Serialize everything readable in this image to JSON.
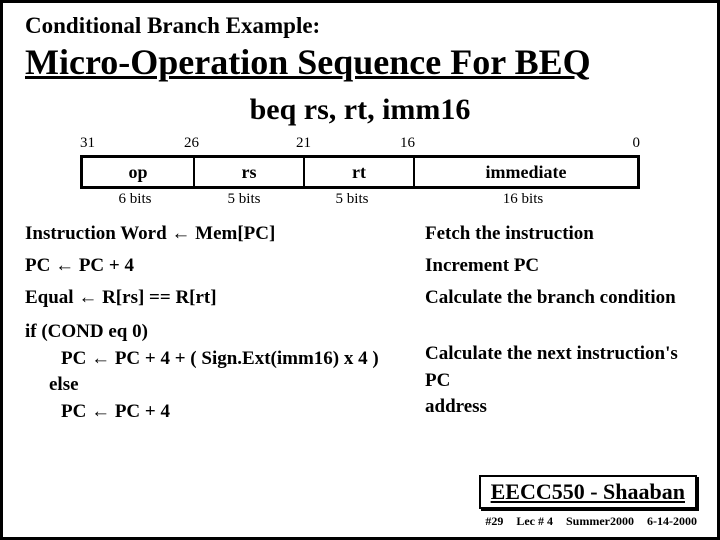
{
  "supertitle": "Conditional Branch Example:",
  "title": "Micro-Operation Sequence For  BEQ",
  "syntax": "beq   rs, rt, imm16",
  "format": {
    "bits": {
      "b31": "31",
      "b26": "26",
      "b21": "21",
      "b16": "16",
      "b0": "0"
    },
    "fields": {
      "op": "op",
      "rs": "rs",
      "rt": "rt",
      "imm": "immediate"
    },
    "sizes": {
      "op": "6 bits",
      "rs": "5 bits",
      "rt": "5 bits",
      "imm": "16 bits"
    }
  },
  "steps": [
    {
      "lhs": "Instruction Word  ←     Mem[PC]",
      "rhs": "Fetch the instruction"
    },
    {
      "lhs": "PC  ←   PC + 4",
      "rhs": "Increment PC"
    },
    {
      "lhs": "Equal  ←   R[rs] == R[rt]",
      "rhs": "Calculate the branch condition"
    }
  ],
  "cond": {
    "l1": "if (COND eq 0)",
    "l2": "PC  ←   PC + 4 + ( Sign.Ext(imm16) x 4 )",
    "l3": "else",
    "l4": "PC  ←   PC + 4",
    "r1": "Calculate the next instruction's PC",
    "r2": "address"
  },
  "footer": {
    "box": "EECC550 - Shaaban",
    "slideno": "#29",
    "lec": "Lec # 4",
    "term": "Summer2000",
    "date": "6-14-2000"
  }
}
